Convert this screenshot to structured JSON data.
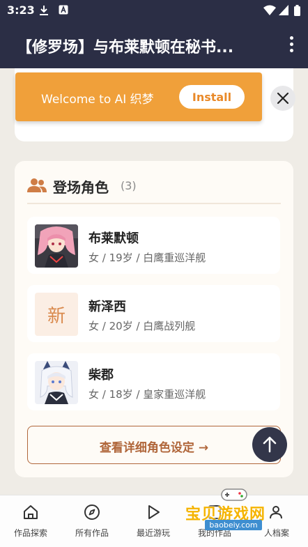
{
  "status_bar": {
    "time": "3:23"
  },
  "app_bar": {
    "title": "【修罗场】与布莱默顿在秘书..."
  },
  "banner": {
    "text": "Welcome to AI 织梦",
    "install_label": "Install"
  },
  "characters_section": {
    "title": "登场角色",
    "count": "(3)",
    "items": [
      {
        "name": "布莱默顿",
        "meta": "女 / 19岁 / 白鹰重巡洋舰",
        "avatar": "photo"
      },
      {
        "name": "新泽西",
        "meta": "女 / 20岁 / 白鹰战列舰",
        "avatar_letter": "新"
      },
      {
        "name": "柴郡",
        "meta": "女 / 18岁 / 皇家重巡洋舰",
        "avatar": "photo"
      }
    ],
    "detail_button": "查看详细角色设定 →"
  },
  "bottom_nav": [
    {
      "label": "作品探索",
      "icon": "home-icon"
    },
    {
      "label": "所有作品",
      "icon": "compass-icon"
    },
    {
      "label": "最近游玩",
      "icon": "play-icon"
    },
    {
      "label": "我的作品",
      "icon": "works-icon"
    },
    {
      "label": "人档案",
      "icon": "profile-icon"
    }
  ],
  "watermark": {
    "text": "宝贝游戏网",
    "sub": "baobeiy.com"
  },
  "colors": {
    "appbar": "#2b2e45",
    "banner": "#f0a03a",
    "accent": "#b0663a",
    "background": "#efece6"
  }
}
